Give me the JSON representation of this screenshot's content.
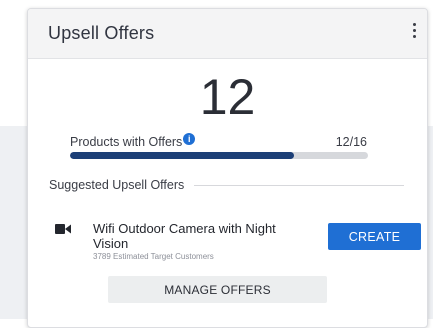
{
  "card": {
    "title": "Upsell Offers",
    "menu_icon": "more-vertical-icon"
  },
  "summary": {
    "count": "12",
    "label": "Products with Offers",
    "info_icon": "info-icon",
    "info_glyph": "i",
    "ratio": "12/16",
    "progress_fraction": 0.75,
    "progress_color": "#1c3f77"
  },
  "suggestions": {
    "title": "Suggested Upsell Offers",
    "items": [
      {
        "icon": "video-camera-icon",
        "name": "Wifi Outdoor Camera with Night Vision",
        "subtext": "3789 Estimated Target Customers",
        "action_label": "CREATE"
      }
    ]
  },
  "footer": {
    "manage_label": "MANAGE OFFERS"
  },
  "colors": {
    "accent": "#1f6fd4",
    "header_bg": "#f4f4f5"
  }
}
